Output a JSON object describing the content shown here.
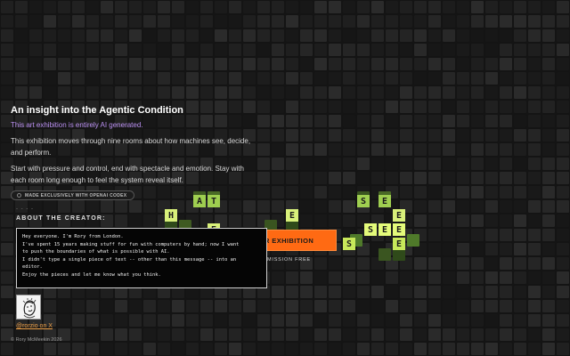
{
  "intro": {
    "title": "An insight into the Agentic Condition",
    "ai_note": "This art exhibition is entirely AI generated.",
    "para1": "This exhibition moves through nine rooms about how machines see, decide, and perform.",
    "para2": "Start with pressure and control, end with spectacle and emotion. Stay with each room long enough to feel the system reveal itself."
  },
  "badge": {
    "label": "MADE EXCLUSIVELY WITH OPENAI CODEX"
  },
  "creator": {
    "dashes": "- - - -",
    "label": "ABOUT THE CREATOR:"
  },
  "tooltip": {
    "lines": [
      "Hey everyone. I'm Rory from London.",
      "I've spent 15 years making stuff for fun with computers by hand; now I want",
      "to push the boundaries of what is possible with AI.",
      "I didn't type a single piece of text -- other than this message -- into an",
      "editor.",
      "Enjoy the pieces and let me know what you think."
    ]
  },
  "cta": {
    "label": "R EXHIBITION",
    "admission": "MISSION FREE"
  },
  "profile": {
    "handle": "@rorzio on X",
    "avatar_icon": "sketch-portrait-icon"
  },
  "footer": {
    "copyright": "© Rory McMeekin 2026"
  },
  "letters": [
    {
      "char": "H",
      "color": "#d8f07a"
    },
    {
      "char": "A",
      "color": "#9fcf50"
    },
    {
      "char": "T",
      "color": "#9fcf50"
    },
    {
      "char": "E",
      "color": "#d8f07a"
    },
    {
      "char": "S",
      "color": "#9fcf50"
    },
    {
      "char": "E",
      "color": "#9fcf50"
    },
    {
      "char": "E",
      "color": "#d8f07a"
    },
    {
      "char": "S",
      "color": "#e4fb7a"
    },
    {
      "char": "E",
      "color": "#e4fb7a"
    },
    {
      "char": "E",
      "color": "#e4fb7a"
    },
    {
      "char": "E",
      "color": "#d8f07a"
    },
    {
      "char": "S",
      "color": "#c8e85a"
    },
    {
      "char": "E",
      "color": "#c8e85a"
    }
  ],
  "colors": {
    "accent": "#ff6a13",
    "purple": "#b98ff0",
    "handle": "#f0a24a",
    "tile_green": "#c8e85a"
  }
}
